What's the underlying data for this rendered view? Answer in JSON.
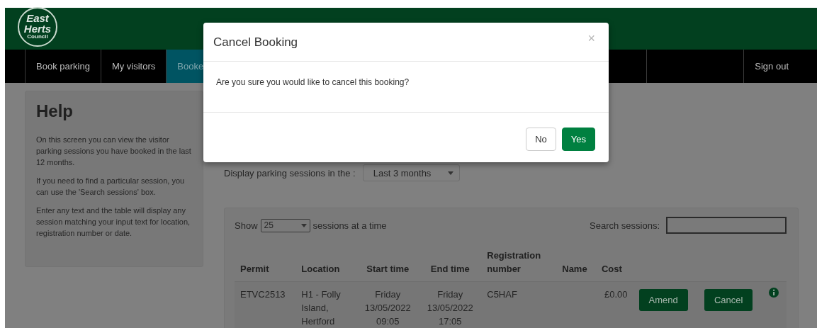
{
  "logo": {
    "lines": [
      "East",
      "Herts",
      "Council"
    ]
  },
  "nav": [
    {
      "label": "Book parking",
      "selected": false
    },
    {
      "label": "My visitors",
      "selected": false
    },
    {
      "label": "Booke",
      "selected": true
    }
  ],
  "nav_right": {
    "label": "Sign out"
  },
  "help": {
    "title": "Help",
    "paragraphs": [
      "On this screen you can view the visitor parking sessions you have booked in the last 12 months.",
      "If you need to find a particular session, you can use the 'Search sessions' box.",
      "Enter any text and the table will display any session matching your input text for location, registration number or date."
    ]
  },
  "period": {
    "label": "Display parking sessions in the :",
    "value": "Last 3 months"
  },
  "table": {
    "show_label": "Show",
    "page_size": "25",
    "show_suffix": "sessions at a time",
    "search_label": "Search sessions:",
    "columns": [
      "Permit",
      "Location",
      "Start time",
      "End time",
      "Registration number",
      "Name",
      "Cost"
    ],
    "rows": [
      {
        "cells": [
          "ETVC2513",
          "H1 - Folly Island, Hertford",
          "Friday 13/05/2022 09:05",
          "Friday 13/05/2022 17:05",
          "C5HAF",
          "",
          "£0.00"
        ],
        "actions": [
          "Amend",
          "Cancel"
        ]
      }
    ]
  },
  "modal": {
    "title": "Cancel Booking",
    "close": "×",
    "message": "Are you sure you would like to cancel this booking?",
    "buttons": [
      {
        "label": "No",
        "kind": "secondary"
      },
      {
        "label": "Yes",
        "kind": "primary"
      }
    ]
  }
}
